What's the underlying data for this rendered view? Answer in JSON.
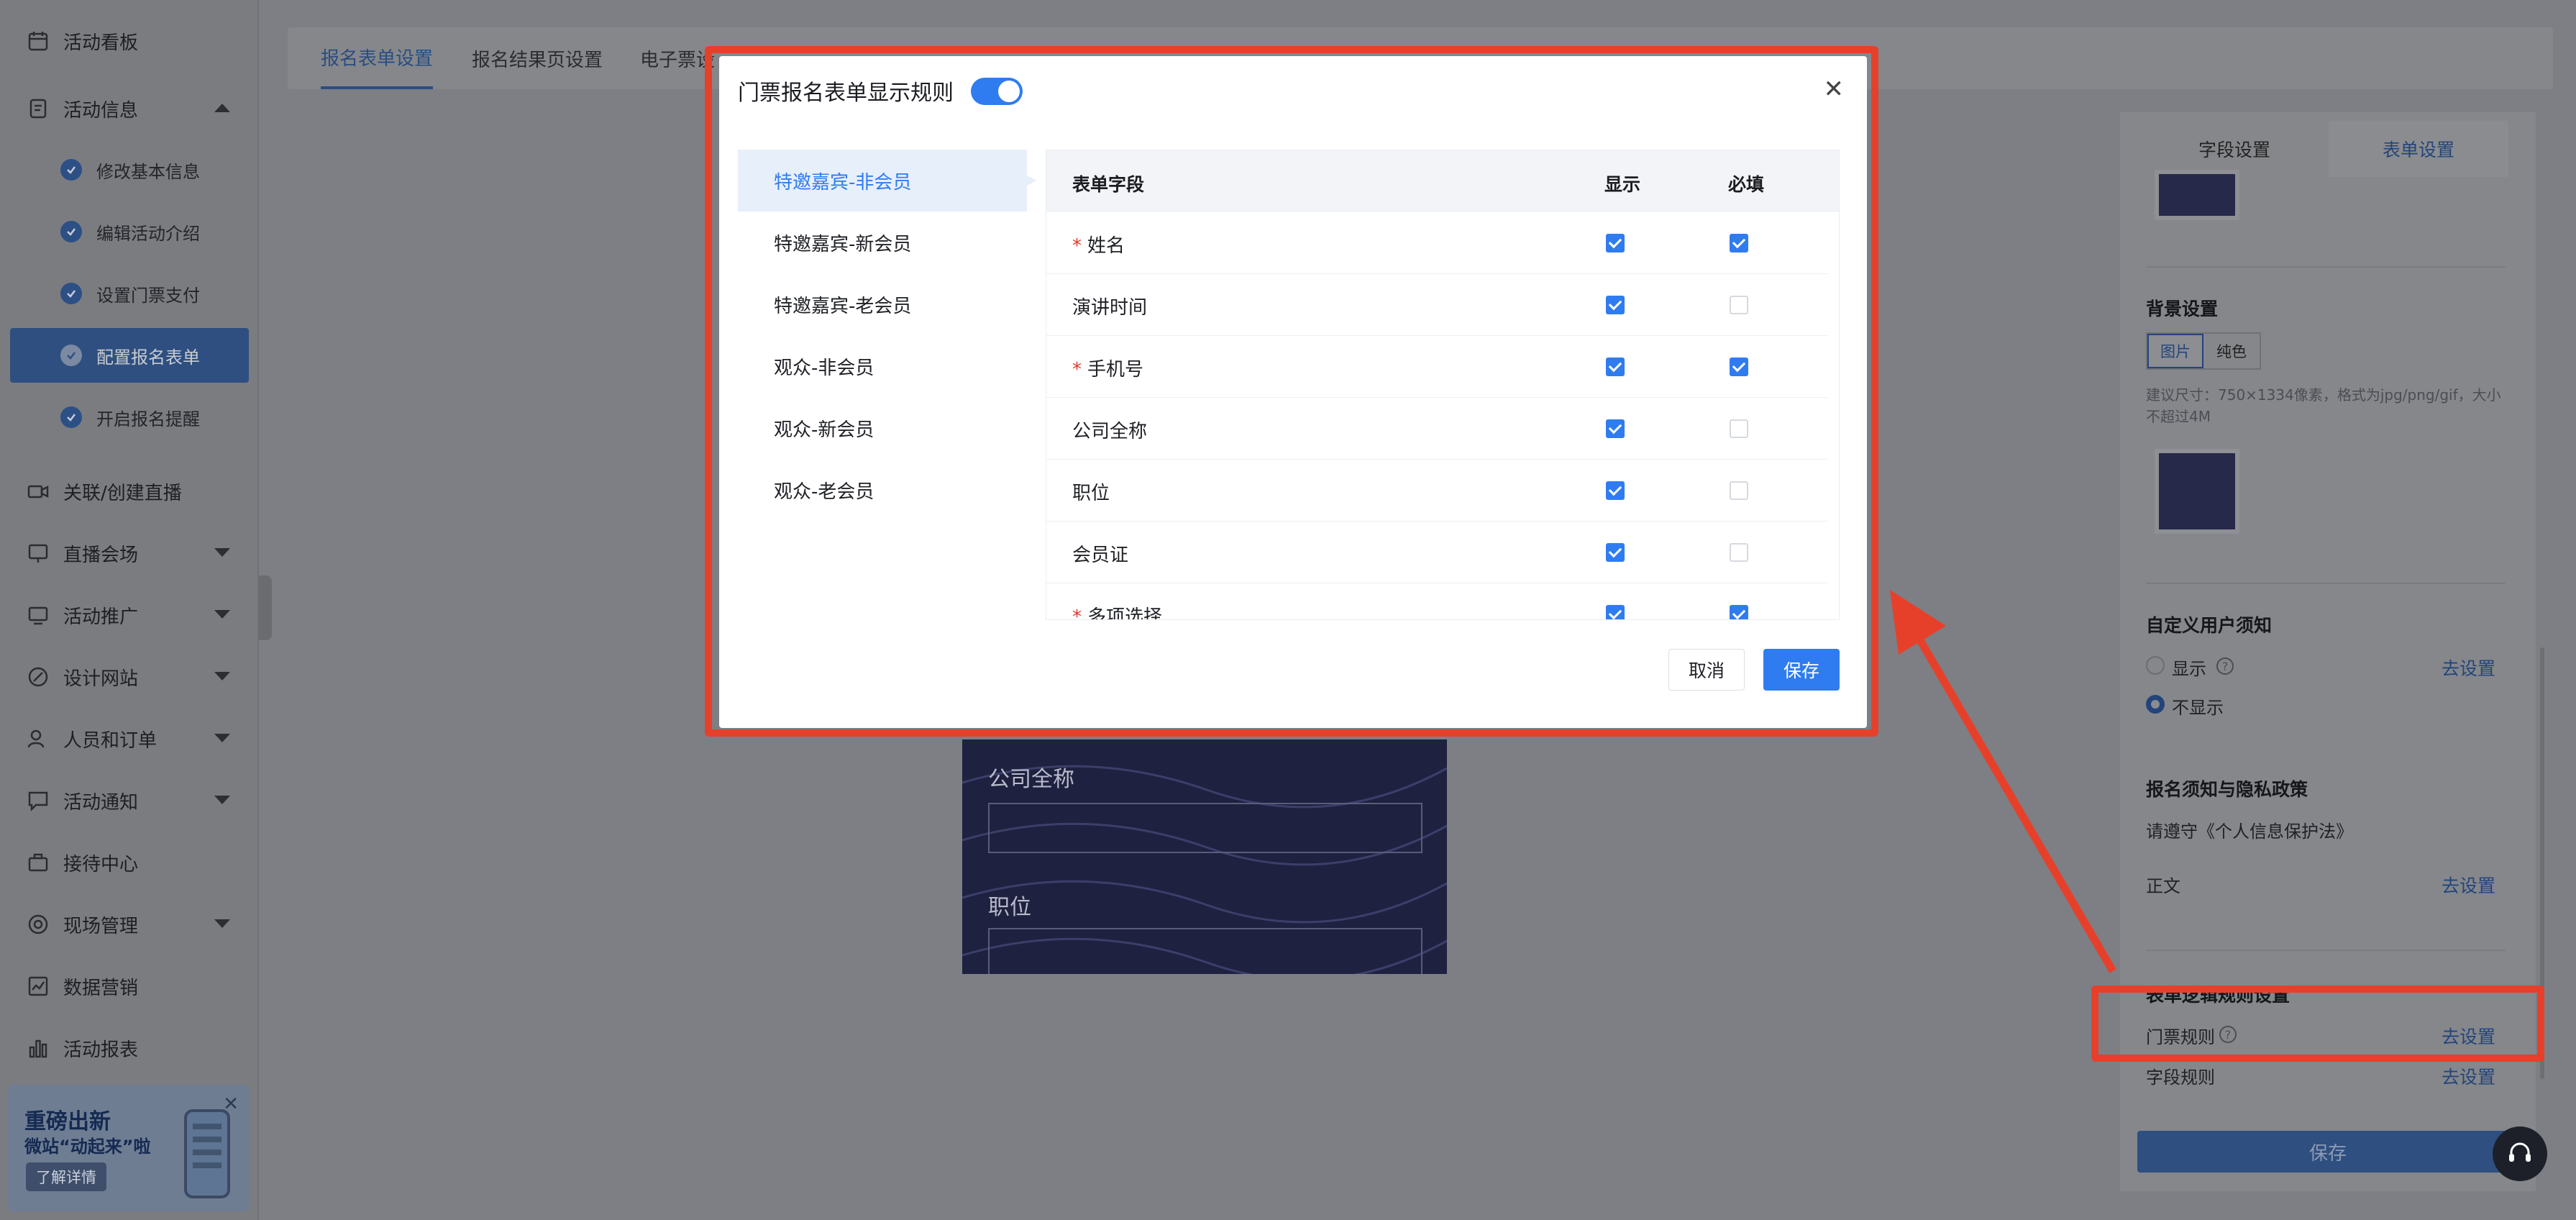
{
  "sidebar": {
    "items": [
      {
        "label": "活动看板",
        "icon": "calendar-icon"
      },
      {
        "label": "活动信息",
        "icon": "document-icon"
      },
      {
        "label": "关联/创建直播",
        "icon": "video-icon"
      },
      {
        "label": "直播会场",
        "icon": "stage-icon"
      },
      {
        "label": "活动推广",
        "icon": "promotion-icon"
      },
      {
        "label": "设计网站",
        "icon": "design-icon"
      },
      {
        "label": "人员和订单",
        "icon": "people-icon"
      },
      {
        "label": "活动通知",
        "icon": "message-icon"
      },
      {
        "label": "接待中心",
        "icon": "briefcase-icon"
      },
      {
        "label": "现场管理",
        "icon": "target-icon"
      },
      {
        "label": "数据营销",
        "icon": "chart-line-icon"
      },
      {
        "label": "活动报表",
        "icon": "bar-chart-icon"
      }
    ],
    "sub_items": [
      "修改基本信息",
      "编辑活动介绍",
      "设置门票支付",
      "配置报名表单",
      "开启报名提醒"
    ],
    "promo": {
      "line1": "重磅出新",
      "line2": "微站“动起来”啦",
      "button": "了解详情"
    }
  },
  "tabs": [
    "报名表单设置",
    "报名结果页设置",
    "电子票设"
  ],
  "preview": {
    "field1": "公司全称",
    "field2": "职位"
  },
  "right_panel": {
    "tabs": [
      "字段设置",
      "表单设置"
    ],
    "bg_title": "背景设置",
    "bg_options": [
      "图片",
      "纯色"
    ],
    "bg_hint": "建议尺寸：750×1334像素，格式为jpg/png/gif，大小不超过4M",
    "notice_title": "自定义用户须知",
    "notice_show": "显示",
    "notice_hide": "不显示",
    "link": "去设置",
    "privacy_title": "报名须知与隐私政策",
    "privacy_text": "请遵守《个人信息保护法》",
    "body_label": "正文",
    "logic_title": "表单逻辑规则设置",
    "ticket_rule": "门票规则",
    "field_rule": "字段规则",
    "save": "保存"
  },
  "modal": {
    "title": "门票报名表单显示规则",
    "toggle_on": true,
    "categories": [
      "特邀嘉宾-非会员",
      "特邀嘉宾-新会员",
      "特邀嘉宾-老会员",
      "观众-非会员",
      "观众-新会员",
      "观众-老会员"
    ],
    "active_category": "特邀嘉宾-非会员",
    "columns": {
      "field": "表单字段",
      "show": "显示",
      "required": "必填"
    },
    "rows": [
      {
        "name": "姓名",
        "mandatory_mark": true,
        "show": true,
        "required": true
      },
      {
        "name": "演讲时间",
        "mandatory_mark": false,
        "show": true,
        "required": false
      },
      {
        "name": "手机号",
        "mandatory_mark": true,
        "show": true,
        "required": true
      },
      {
        "name": "公司全称",
        "mandatory_mark": false,
        "show": true,
        "required": false
      },
      {
        "name": "职位",
        "mandatory_mark": false,
        "show": true,
        "required": false
      },
      {
        "name": "会员证",
        "mandatory_mark": false,
        "show": true,
        "required": false
      },
      {
        "name": "多项选择",
        "mandatory_mark": true,
        "show": true,
        "required": true
      }
    ],
    "cancel": "取消",
    "save": "保存"
  },
  "colors": {
    "accent": "#2f7cf0",
    "annotation": "#e6402b"
  }
}
